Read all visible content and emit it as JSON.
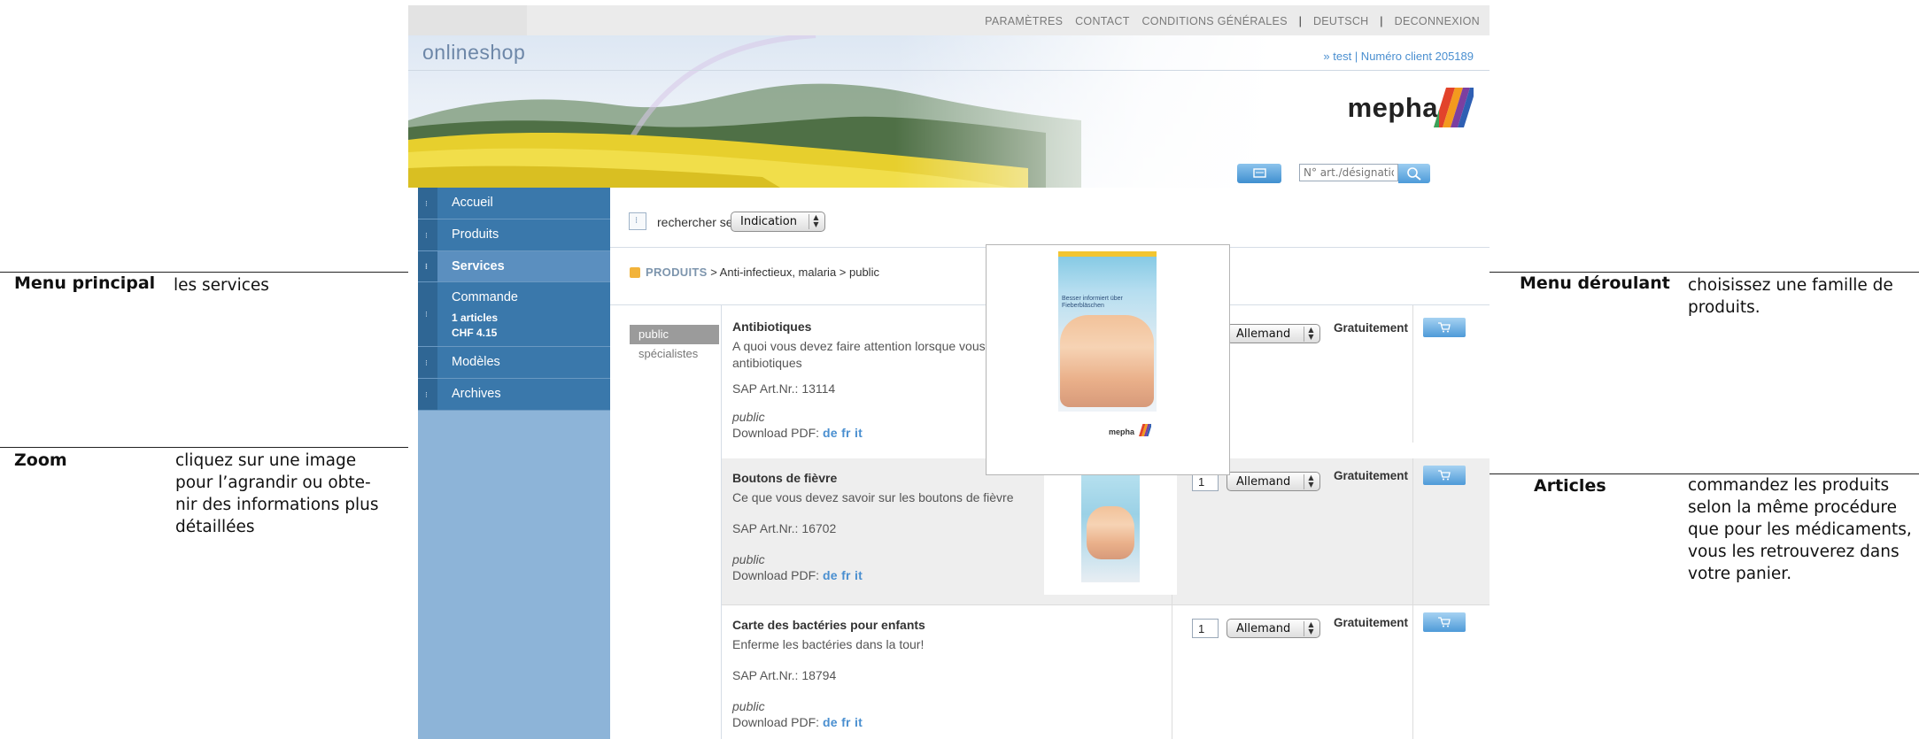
{
  "annotations": {
    "menu_principal": {
      "title": "Menu principal",
      "text": "les services"
    },
    "zoom": {
      "title": "Zoom",
      "text": "cliquez sur une image pour l’agrandir ou obte-nir des informations plus détaillées"
    },
    "menu_deroulant": {
      "title": "Menu déroulant",
      "text": "choisissez une famille de produits."
    },
    "articles": {
      "title": "Articles",
      "text": "commandez les produits selon la même procédure que pour les médicaments, vous les retrouverez dans votre panier."
    }
  },
  "topnav": {
    "parametres": "PARAMÈTRES",
    "contact": "CONTACT",
    "conditions": "CONDITIONS GÉNÉRALES",
    "deutsch": "DEUTSCH",
    "deconnexion": "DECONNEXION",
    "separator": "|"
  },
  "header": {
    "shop_title": "onlineshop",
    "user_info": "» test | Numéro client 205189",
    "logo_text": "mepha",
    "search_placeholder": "N° art./désignation"
  },
  "sidebar": {
    "items": [
      {
        "label": "Accueil"
      },
      {
        "label": "Produits"
      },
      {
        "label": "Services"
      },
      {
        "label": "Commande",
        "sub1": "1 articles",
        "sub2": "CHF 4.15"
      },
      {
        "label": "Modèles"
      },
      {
        "label": "Archives"
      }
    ]
  },
  "main": {
    "search_label": "rechercher selon",
    "search_select": "Indication",
    "breadcrumb_first": "PRODUITS",
    "breadcrumb_rest": " > Anti-infectieux, malaria > public",
    "audience": [
      "public",
      "spécialistes"
    ]
  },
  "products": [
    {
      "name": "Antibiotiques",
      "desc": "A quoi vous devez faire attention lorsque vous des antibiotiques",
      "sap": "SAP Art.Nr.: 13114",
      "audience": "public",
      "pdf_label": "Download PDF: ",
      "pdf_links": "de fr it",
      "language": "Allemand",
      "price": "Gratuitement"
    },
    {
      "name": "Boutons de fièvre",
      "desc": "Ce que vous devez savoir sur les boutons de fièvre",
      "sap": "SAP Art.Nr.: 16702",
      "audience": "public",
      "pdf_label": "Download PDF: ",
      "pdf_links": "de fr it",
      "quantity": "1",
      "language": "Allemand",
      "price": "Gratuitement"
    },
    {
      "name": "Carte des bactéries pour enfants",
      "desc": "Enferme les bactéries dans la tour!",
      "sap": "SAP Art.Nr.: 18794",
      "audience": "public",
      "pdf_label": "Download PDF: ",
      "pdf_links": "de fr it",
      "quantity": "1",
      "language": "Allemand",
      "price": "Gratuitement"
    }
  ],
  "zoom_popup": {
    "leaflet_title": "Besser informiert über Fieberbläschen",
    "leaflet_brand": "mepha"
  },
  "colors": {
    "nav_blue": "#3a78ab",
    "nav_active": "#5b8fbf",
    "sidebar_bg": "#8db4d8",
    "link_blue": "#4a8fd0",
    "breadcrumb_square": "#f2b33a"
  }
}
